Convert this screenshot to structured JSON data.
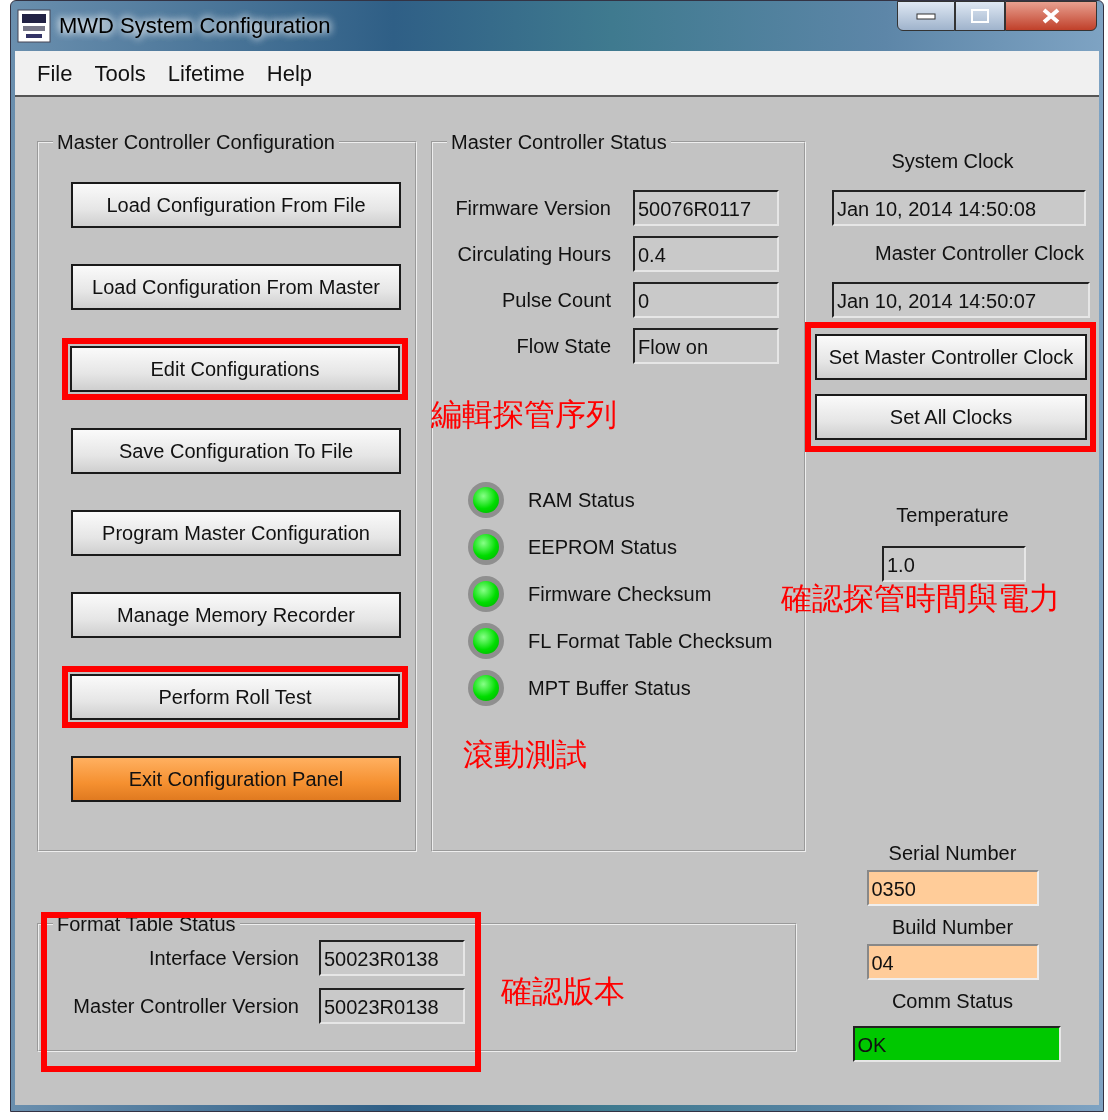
{
  "window": {
    "title": "MWD System Configuration"
  },
  "menu": [
    "File",
    "Tools",
    "Lifetime",
    "Help"
  ],
  "config_group": {
    "title": "Master Controller Configuration",
    "buttons": [
      {
        "label": "Load Configuration From File",
        "kind": "normal",
        "highlighted": false
      },
      {
        "label": "Load Configuration From Master",
        "kind": "normal",
        "highlighted": false
      },
      {
        "label": "Edit Configurations",
        "kind": "normal",
        "highlighted": true
      },
      {
        "label": "Save Configuration To File",
        "kind": "normal",
        "highlighted": false
      },
      {
        "label": "Program Master Configuration",
        "kind": "normal",
        "highlighted": false
      },
      {
        "label": "Manage Memory Recorder",
        "kind": "normal",
        "highlighted": false
      },
      {
        "label": "Perform Roll Test",
        "kind": "normal",
        "highlighted": true
      },
      {
        "label": "Exit Configuration Panel",
        "kind": "exit",
        "highlighted": false
      }
    ]
  },
  "status_group": {
    "title": "Master Controller Status",
    "fields": [
      {
        "label": "Firmware Version",
        "value": "50076R0117"
      },
      {
        "label": "Circulating Hours",
        "value": "0.4"
      },
      {
        "label": "Pulse Count",
        "value": "0"
      },
      {
        "label": "Flow State",
        "value": "Flow on"
      }
    ],
    "indicators": [
      {
        "label": "RAM Status",
        "on": true
      },
      {
        "label": "EEPROM Status",
        "on": true
      },
      {
        "label": "Firmware Checksum",
        "on": true
      },
      {
        "label": "FL Format Table Checksum",
        "on": true
      },
      {
        "label": "MPT Buffer Status",
        "on": true
      }
    ]
  },
  "clocks": {
    "system_label": "System Clock",
    "system_value": "Jan 10, 2014 14:50:08",
    "master_label": "Master Controller Clock",
    "master_value": "Jan 10, 2014 14:50:07",
    "buttons": [
      "Set Master Controller Clock",
      "Set All Clocks"
    ],
    "highlighted": true
  },
  "temperature": {
    "label": "Temperature",
    "value": "1.0"
  },
  "format_table": {
    "title": "Format Table Status",
    "highlighted": true,
    "fields": [
      {
        "label": "Interface Version",
        "value": "50023R0138"
      },
      {
        "label": "Master Controller Version",
        "value": "50023R0138"
      }
    ]
  },
  "device": [
    {
      "label": "Serial Number",
      "value": "0350",
      "kind": "info"
    },
    {
      "label": "Build Number",
      "value": "04",
      "kind": "info"
    },
    {
      "label": "Comm Status",
      "value": "OK",
      "kind": "ok"
    }
  ],
  "annotations": [
    {
      "text": "編輯探管序列"
    },
    {
      "text": "滾動測試"
    },
    {
      "text": "確認探管時間與電力"
    },
    {
      "text": "確認版本"
    }
  ]
}
